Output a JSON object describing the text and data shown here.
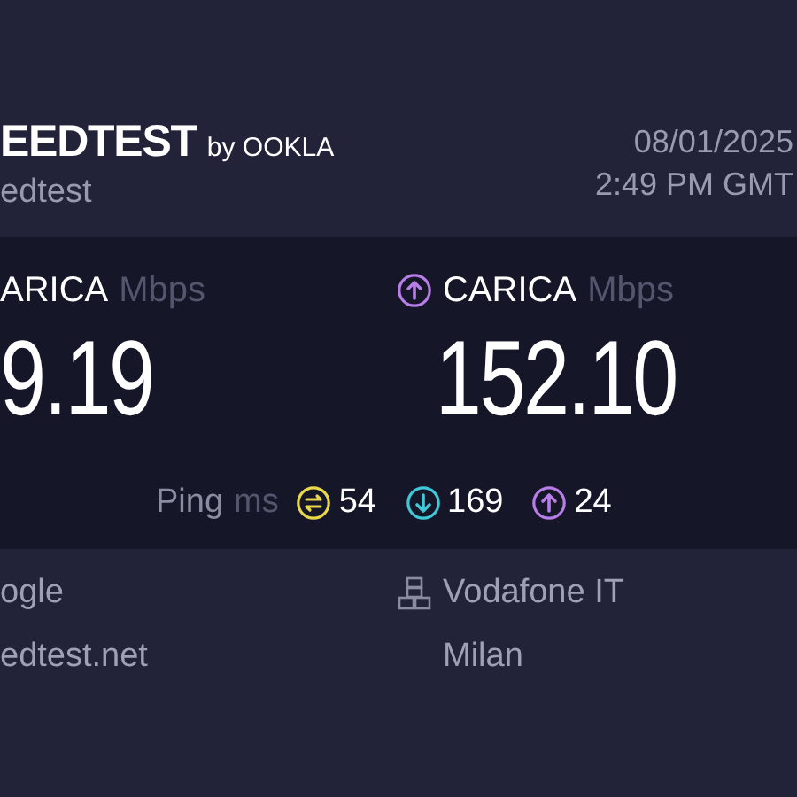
{
  "header": {
    "brand": "EEDTEST",
    "brand_suffix": "by OOKLA",
    "subtitle": "edtest",
    "date": "08/01/2025",
    "time": "2:49 PM GMT"
  },
  "results": [
    {
      "label": "ARICA",
      "unit": "Mbps",
      "value": "9.19",
      "show_icon": false
    },
    {
      "label": "CARICA",
      "unit": "Mbps",
      "value": "152.10",
      "show_icon": true
    }
  ],
  "ping": {
    "label": "Ping",
    "unit": "ms",
    "items": [
      {
        "kind": "idle",
        "value": "54",
        "color": "#e8d84a"
      },
      {
        "kind": "download",
        "value": "169",
        "color": "#3ec8d8"
      },
      {
        "kind": "upload",
        "value": "24",
        "color": "#b77ee8"
      }
    ]
  },
  "provider": {
    "name": "ogle",
    "host": "edtest.net"
  },
  "server": {
    "name": "Vodafone IT",
    "city": "Milan"
  }
}
